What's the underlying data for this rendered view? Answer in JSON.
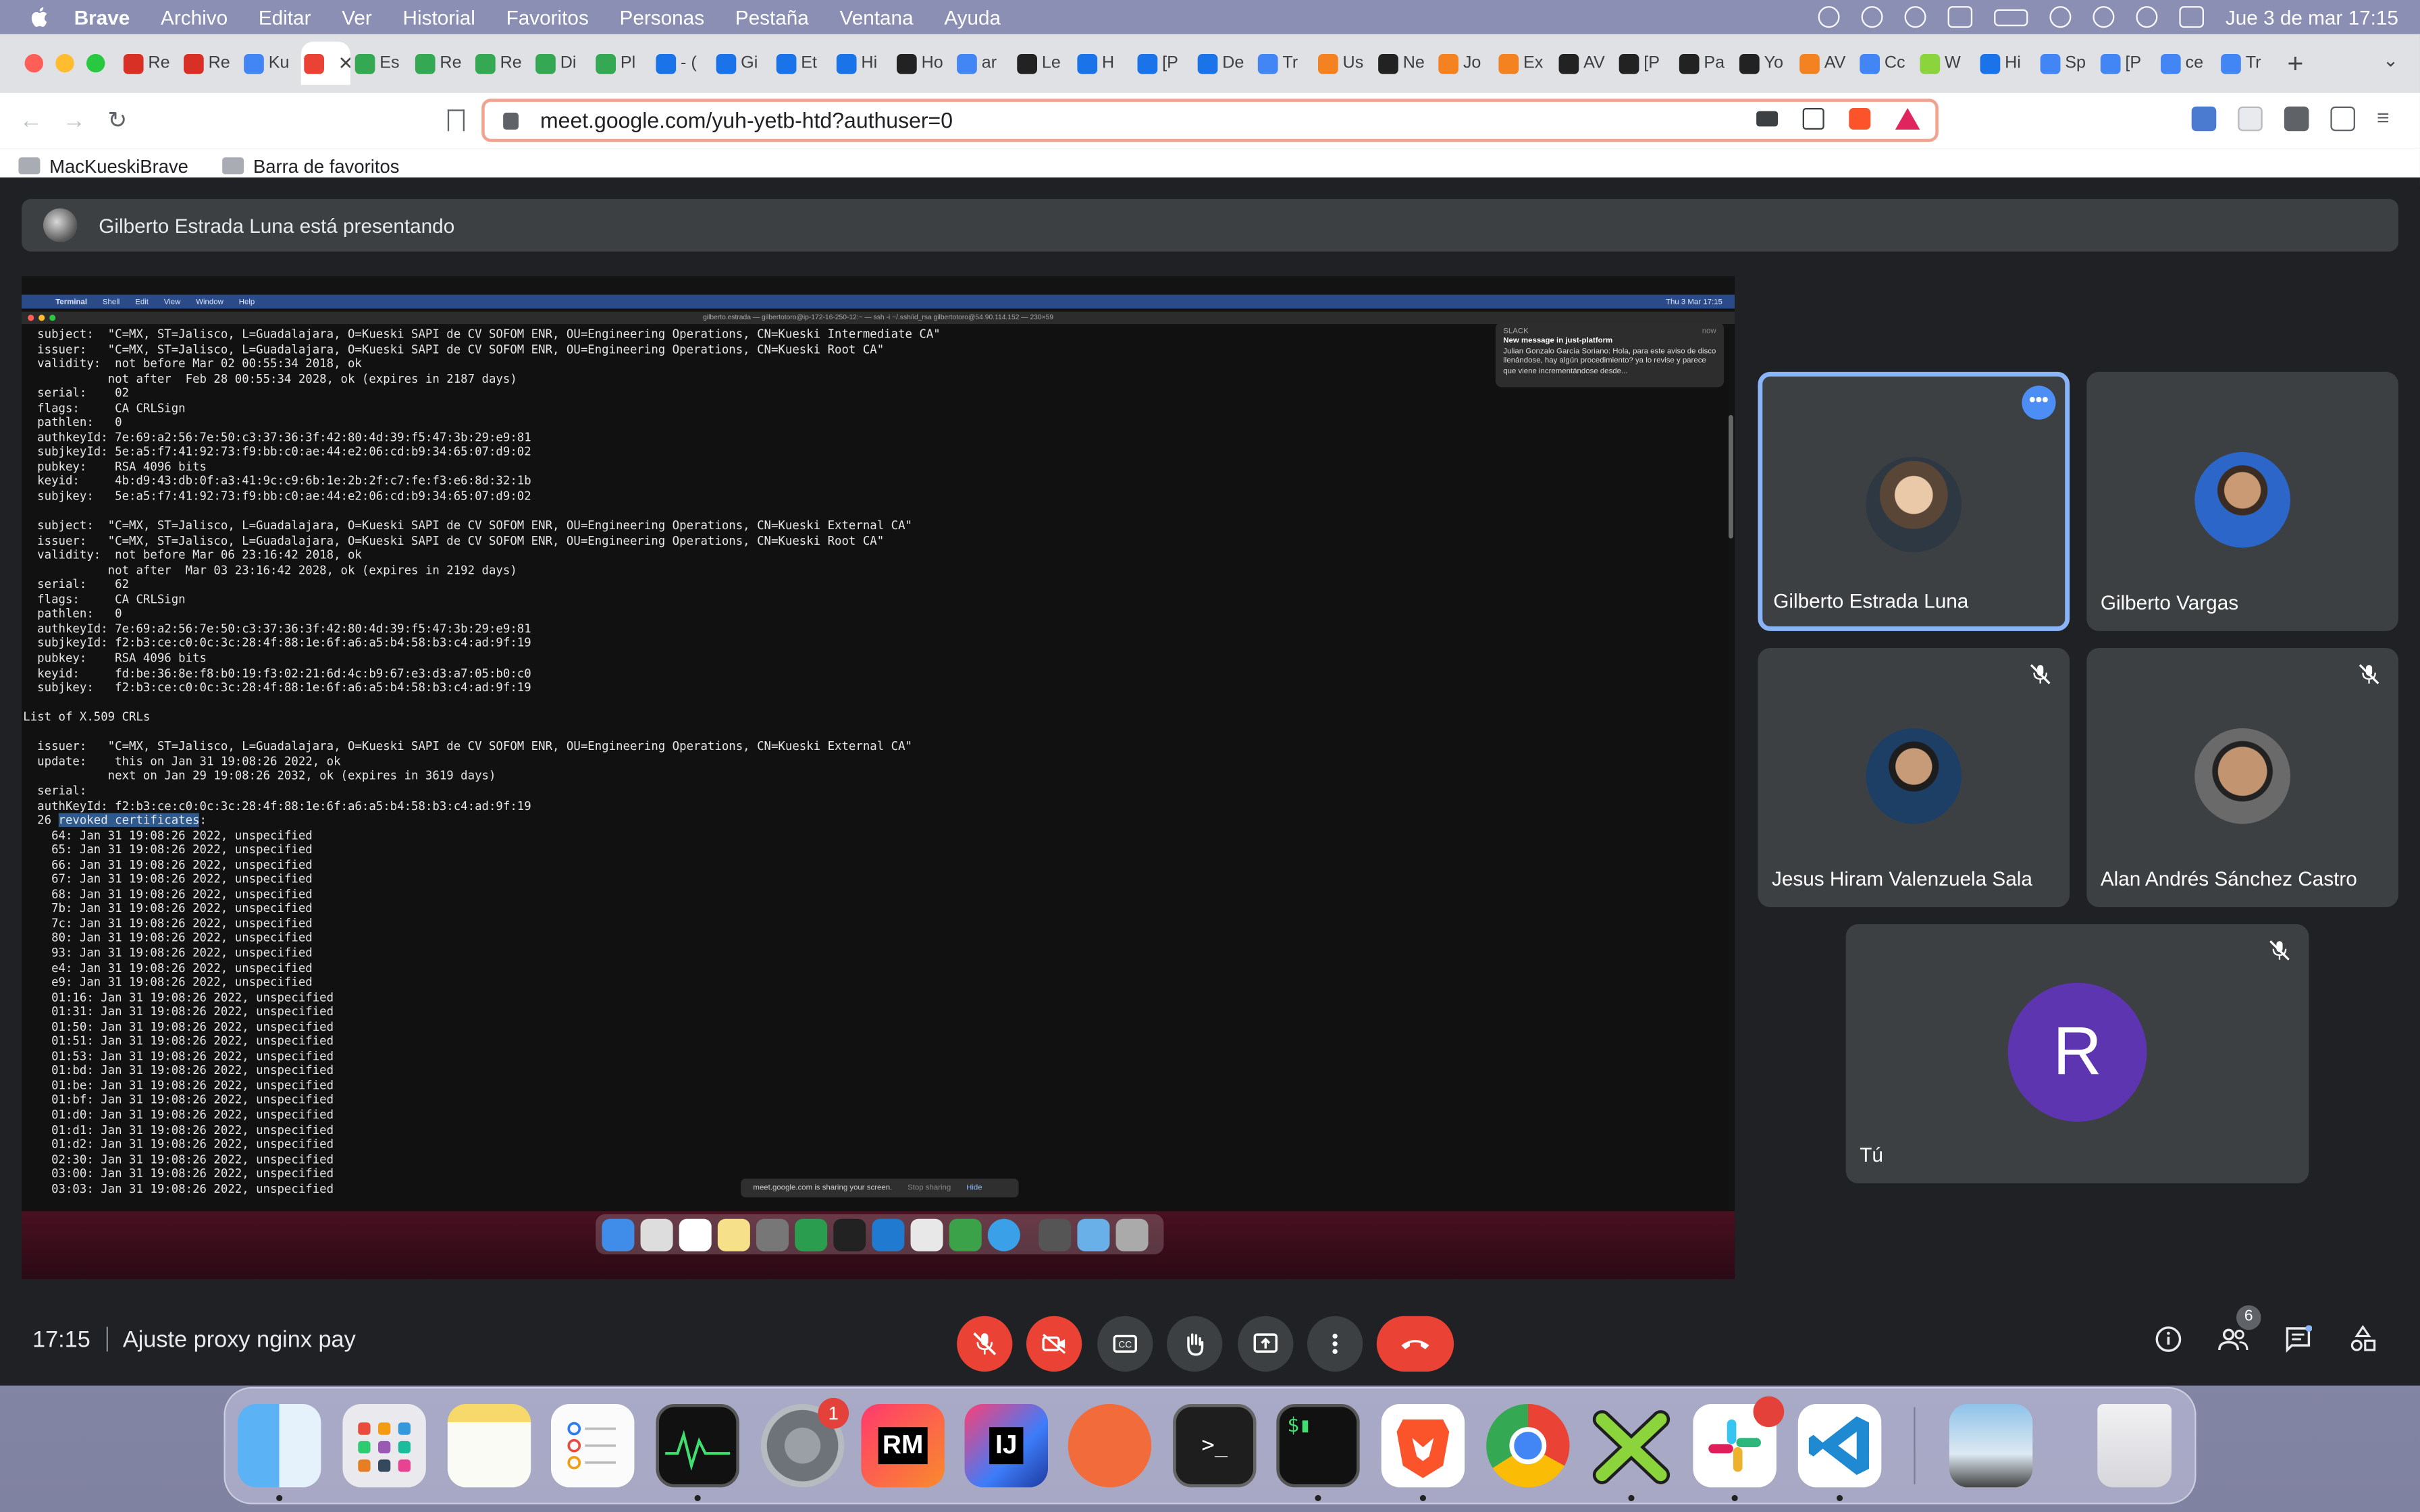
{
  "menubar": {
    "items": [
      "Brave",
      "Archivo",
      "Editar",
      "Ver",
      "Historial",
      "Favoritos",
      "Personas",
      "Pestaña",
      "Ventana",
      "Ayuda"
    ],
    "clock": "Jue 3 de mar  17:15"
  },
  "browser": {
    "tabs": [
      "Re",
      "Re",
      "Ku",
      "",
      "Es",
      "Re",
      "Re",
      "Di",
      "Pl",
      "- (",
      "Gi",
      "Et",
      "Hi",
      "Ho",
      "ar",
      "Le",
      "H",
      "[P",
      "De",
      "Tr",
      "Us",
      "Ne",
      "Jo",
      "Ex",
      "AV",
      "[P",
      "Pa",
      "Yo",
      "AV",
      "Cc",
      "W",
      "Hi",
      "Sp",
      "[P",
      "ce",
      "Tr"
    ],
    "url": "meet.google.com/yuh-yetb-htd?authuser=0",
    "bookmarks": [
      "MacKueskiBrave",
      "Barra de favoritos"
    ]
  },
  "meet": {
    "presenting_text": "Gilberto Estrada Luna está presentando",
    "time": "17:15",
    "meeting_title": "Ajuste proxy nginx pay",
    "participant_count": "6",
    "participants": [
      {
        "name": "Gilberto Estrada Luna",
        "muted": false,
        "speaking": true
      },
      {
        "name": "Gilberto Vargas",
        "muted": false
      },
      {
        "name": "Jesus Hiram Valenzuela Sala",
        "muted": true
      },
      {
        "name": "Alan Andrés Sánchez Castro",
        "muted": true
      }
    ],
    "self": {
      "name": "Tú",
      "initial": "R",
      "muted": true
    }
  },
  "shared_screen": {
    "menu": [
      "Terminal",
      "Shell",
      "Edit",
      "View",
      "Window",
      "Help"
    ],
    "window_title": "gilberto.estrada — gilbertotoro@ip-172-16-250-12:~ — ssh -i ~/.ssh/id_rsa gilbertotoro@54.90.114.152 — 230×59",
    "menu_clock": "Thu 3 Mar  17:15",
    "notification": {
      "app": "SLACK",
      "time": "now",
      "title": "New message in just-platform",
      "body": "Julian Gonzalo García Soriano: Hola, para este aviso de disco llenándose, hay algún procedimiento? ya lo revise y parece que viene incrementándose desde..."
    },
    "sharing_bar": {
      "text": "meet.google.com is sharing your screen.",
      "stop": "Stop sharing",
      "hide": "Hide"
    },
    "terminal_lines": [
      "  subject:  \"C=MX, ST=Jalisco, L=Guadalajara, O=Kueski SAPI de CV SOFOM ENR, OU=Engineering Operations, CN=Kueski Intermediate CA\"",
      "  issuer:   \"C=MX, ST=Jalisco, L=Guadalajara, O=Kueski SAPI de CV SOFOM ENR, OU=Engineering Operations, CN=Kueski Root CA\"",
      "  validity:  not before Mar 02 00:55:34 2018, ok",
      "            not after  Feb 28 00:55:34 2028, ok (expires in 2187 days)",
      "  serial:    02",
      "  flags:     CA CRLSign",
      "  pathlen:   0",
      "  authkeyId: 7e:69:a2:56:7e:50:c3:37:36:3f:42:80:4d:39:f5:47:3b:29:e9:81",
      "  subjkeyId: 5e:a5:f7:41:92:73:f9:bb:c0:ae:44:e2:06:cd:b9:34:65:07:d9:02",
      "  pubkey:    RSA 4096 bits",
      "  keyid:     4b:d9:43:db:0f:a3:41:9c:c9:6b:1e:2b:2f:c7:fe:f3:e6:8d:32:1b",
      "  subjkey:   5e:a5:f7:41:92:73:f9:bb:c0:ae:44:e2:06:cd:b9:34:65:07:d9:02",
      "",
      "  subject:  \"C=MX, ST=Jalisco, L=Guadalajara, O=Kueski SAPI de CV SOFOM ENR, OU=Engineering Operations, CN=Kueski External CA\"",
      "  issuer:   \"C=MX, ST=Jalisco, L=Guadalajara, O=Kueski SAPI de CV SOFOM ENR, OU=Engineering Operations, CN=Kueski Root CA\"",
      "  validity:  not before Mar 06 23:16:42 2018, ok",
      "            not after  Mar 03 23:16:42 2028, ok (expires in 2192 days)",
      "  serial:    62",
      "  flags:     CA CRLSign",
      "  pathlen:   0",
      "  authkeyId: 7e:69:a2:56:7e:50:c3:37:36:3f:42:80:4d:39:f5:47:3b:29:e9:81",
      "  subjkeyId: f2:b3:ce:c0:0c:3c:28:4f:88:1e:6f:a6:a5:b4:58:b3:c4:ad:9f:19",
      "  pubkey:    RSA 4096 bits",
      "  keyid:     fd:be:36:8e:f8:b0:19:f3:02:21:6d:4c:b9:67:e3:d3:a7:05:b0:c0",
      "  subjkey:   f2:b3:ce:c0:0c:3c:28:4f:88:1e:6f:a6:a5:b4:58:b3:c4:ad:9f:19",
      "",
      "List of X.509 CRLs",
      "",
      "  issuer:   \"C=MX, ST=Jalisco, L=Guadalajara, O=Kueski SAPI de CV SOFOM ENR, OU=Engineering Operations, CN=Kueski External CA\"",
      "  update:    this on Jan 31 19:08:26 2022, ok",
      "            next on Jan 29 19:08:26 2032, ok (expires in 3619 days)",
      "  serial:"
    ],
    "authkey_line": "  authKeyId: f2:b3:ce:c0:0c:3c:28:4f:88:1e:6f:a6:a5:b4:58:b3:c4:ad:9f:19",
    "revoked_count": "  26 ",
    "revoked_label": "revoked certificates",
    "revoked": [
      "    64: Jan 31 19:08:26 2022, unspecified",
      "    65: Jan 31 19:08:26 2022, unspecified",
      "    66: Jan 31 19:08:26 2022, unspecified",
      "    67: Jan 31 19:08:26 2022, unspecified",
      "    68: Jan 31 19:08:26 2022, unspecified",
      "    7b: Jan 31 19:08:26 2022, unspecified",
      "    7c: Jan 31 19:08:26 2022, unspecified",
      "    80: Jan 31 19:08:26 2022, unspecified",
      "    93: Jan 31 19:08:26 2022, unspecified",
      "    e4: Jan 31 19:08:26 2022, unspecified",
      "    e9: Jan 31 19:08:26 2022, unspecified",
      "    01:16: Jan 31 19:08:26 2022, unspecified",
      "    01:31: Jan 31 19:08:26 2022, unspecified",
      "    01:50: Jan 31 19:08:26 2022, unspecified",
      "    01:51: Jan 31 19:08:26 2022, unspecified",
      "    01:53: Jan 31 19:08:26 2022, unspecified",
      "    01:bd: Jan 31 19:08:26 2022, unspecified",
      "    01:be: Jan 31 19:08:26 2022, unspecified",
      "    01:bf: Jan 31 19:08:26 2022, unspecified",
      "    01:d0: Jan 31 19:08:26 2022, unspecified",
      "    01:d1: Jan 31 19:08:26 2022, unspecified",
      "    01:d2: Jan 31 19:08:26 2022, unspecified",
      "    02:30: Jan 31 19:08:26 2022, unspecified",
      "    03:00: Jan 31 19:08:26 2022, unspecified",
      "    03:03: Jan 31 19:08:26 2022, unspecified"
    ]
  },
  "dock": {
    "apps": [
      "Finder",
      "Launchpad",
      "Notes",
      "Reminders",
      "Activity Monitor",
      "System Preferences",
      "RubyMine",
      "IntelliJ IDEA",
      "Postman",
      "Terminal",
      "iTerm",
      "Brave",
      "Chrome",
      "XMind",
      "Slack",
      "Visual Studio Code",
      "Preview",
      "Trash"
    ],
    "system_prefs_badge": "1",
    "rm_label": "RM",
    "ij_label": "IJ"
  },
  "colors": {
    "end_call": "#ea4335",
    "self_avatar": "#5e35b1",
    "active_tile_border": "#8ab4f8"
  }
}
